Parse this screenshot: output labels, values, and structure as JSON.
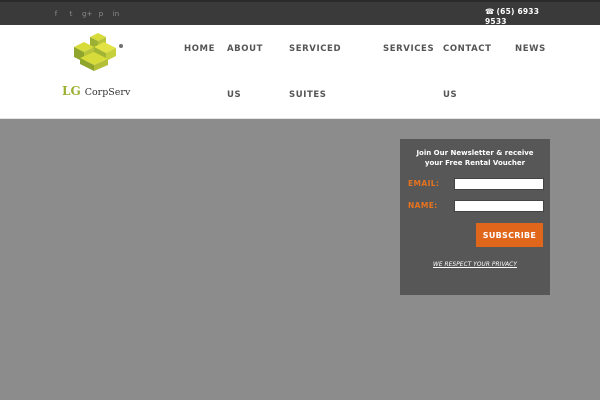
{
  "topbar": {
    "social": [
      {
        "glyph": "f",
        "icon": "facebook-icon"
      },
      {
        "glyph": "t",
        "icon": "twitter-icon"
      },
      {
        "glyph": "g+",
        "icon": "google-plus-icon"
      },
      {
        "glyph": "p",
        "icon": "pinterest-icon"
      },
      {
        "glyph": "in",
        "icon": "linkedin-icon"
      }
    ],
    "phone_icon": "☎",
    "phone_text": "(65) 6933 9533"
  },
  "logo": {
    "lg": "LG",
    "corpserv": "CorpServ",
    "brand_green": "#9cb033",
    "brand_yellow": "#d8dc3a"
  },
  "nav": {
    "home": "HOME",
    "about_line1": "ABOUT",
    "about_line2": "US",
    "serviced_line1": "SERVICED",
    "serviced_line2": "SUITES",
    "services": "SERVICES",
    "contact_line1": "CONTACT",
    "contact_line2": "US",
    "news": "NEWS"
  },
  "newsletter": {
    "title": "Join Our Newsletter & receive your Free Rental Voucher",
    "email_label": "EMAIL:",
    "email_value": "",
    "name_label": "NAME:",
    "name_value": "",
    "subscribe_label": "SUBSCRIBE",
    "privacy_text": "WE RESPECT YOUR PRIVACY",
    "accent_color": "#e0661c"
  }
}
